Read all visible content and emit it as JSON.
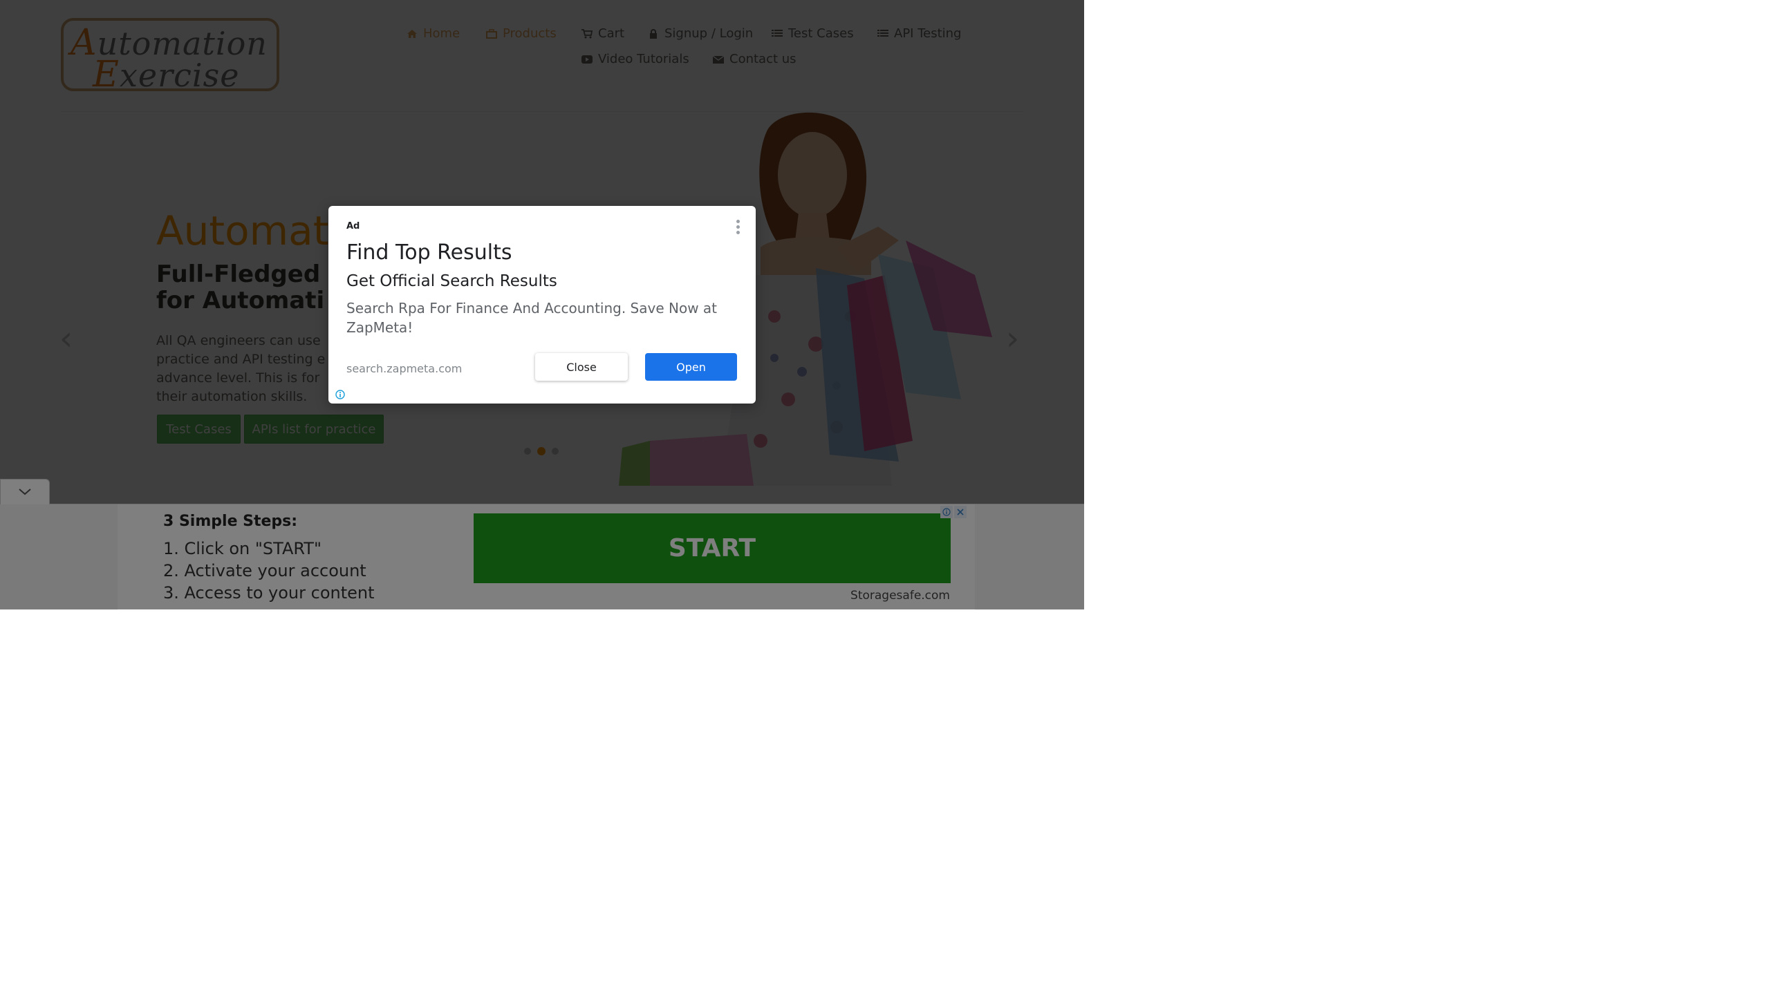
{
  "header": {
    "logo": {
      "line1_cap": "A",
      "line1_rest": "utomation",
      "line2_cap": "E",
      "line2_rest": "xercise"
    },
    "nav": [
      {
        "label": "Home",
        "icon": "home-icon"
      },
      {
        "label": "Products",
        "icon": "briefcase-icon"
      },
      {
        "label": "Cart",
        "icon": "cart-icon"
      },
      {
        "label": "Signup / Login",
        "icon": "lock-icon"
      },
      {
        "label": "Test Cases",
        "icon": "list-icon"
      },
      {
        "label": "API Testing",
        "icon": "list-icon"
      },
      {
        "label": "Video Tutorials",
        "icon": "youtube-icon"
      },
      {
        "label": "Contact us",
        "icon": "envelope-icon"
      }
    ]
  },
  "hero": {
    "title": "Automat",
    "subtitle_line1": "Full-Fledged",
    "subtitle_line2": "for Automati",
    "description_lines": [
      "All QA engineers can use",
      "practice and API testing e",
      "advance level. This is for",
      "their automation skills."
    ],
    "btn_test_cases": "Test Cases",
    "btn_apis": "APIs list for practice",
    "prev_arrow": "‹",
    "next_arrow": "›"
  },
  "ad_modal": {
    "ad_label": "Ad",
    "title": "Find Top Results",
    "subtitle": "Get Official Search Results",
    "description": "Search Rpa For Finance And Accounting. Save Now at ZapMeta!",
    "url": "search.zapmeta.com",
    "close_label": "Close",
    "open_label": "Open"
  },
  "bottom_ad": {
    "steps_title": "3 Simple Steps:",
    "steps": [
      "1. Click on \"START\"",
      "2. Activate your account",
      "3. Access to your content"
    ],
    "start_label": "START",
    "sponsor": "Storagesafe.com"
  },
  "colors": {
    "accent": "#fe980f",
    "green": "#5cb85c",
    "ad_blue": "#1a73e8",
    "start_green": "#1ea11e"
  }
}
